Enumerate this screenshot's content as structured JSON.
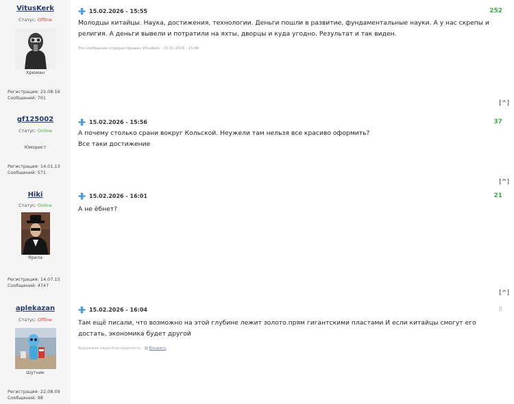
{
  "posts": [
    {
      "username": "VitusKerk",
      "status_label": "Статус:",
      "status_value": "Offline",
      "rank": "Хрюман",
      "reg": "Регистрация: 25.08.16",
      "messages": "Сообщений: 701",
      "date": "15.02.2026 - 15:55",
      "rating": "252",
      "text": "Молодцы китайцы. Наука, достижения, технологии. Деньги пошли в развитие, фундаментальные науки. А у нас скрепы и религия. А деньги вывели и потратили на яхты, дворцы и куда угодно. Результат и так виден.",
      "edited": "Это сообщение отредактировал VitusKerk - 15.02.2026 - 15:56",
      "to_top": "[^]"
    },
    {
      "username": "gf125002",
      "status_label": "Статус:",
      "status_value": "Online",
      "rank": "Юморист",
      "reg": "Регистрация: 14.01.13",
      "messages": "Сообщений: 571",
      "date": "15.02.2026 - 15:56",
      "rating": "37",
      "text_lines": [
        "А почему столько срани вокруг Кольской. Неужели там нельзя все красиво оформить?",
        "Все таки достижение"
      ],
      "to_top": "[^]"
    },
    {
      "username": "Hiki",
      "status_label": "Статус:",
      "status_value": "Online",
      "rank": "Ярила",
      "reg": "Регистрация: 14.07.15",
      "messages": "Сообщений: 4747",
      "date": "15.02.2026 - 16:01",
      "rating": "21",
      "text": "А не ёбнет?",
      "to_top": "[^]"
    },
    {
      "username": "aplekazan",
      "status_label": "Статус:",
      "status_value": "Offline",
      "rank": "Шутник",
      "reg": "Регистрация: 22.08.09",
      "messages": "Сообщений: 98",
      "date": "15.02.2026 - 16:04",
      "rating": "8",
      "text": "Там ещё писали, что возможно на этой глубине лежит золото.прям гигантскими пластами И если китайцы смогут его достать, экономика будет другой",
      "thanks_label": "Выражаем наши благодарность",
      "thanks_link": "Вложить"
    }
  ],
  "colors": {
    "accent_green": "#3aa842",
    "offline_red": "#d63838",
    "sidebar_bg": "#f5f5f5"
  }
}
